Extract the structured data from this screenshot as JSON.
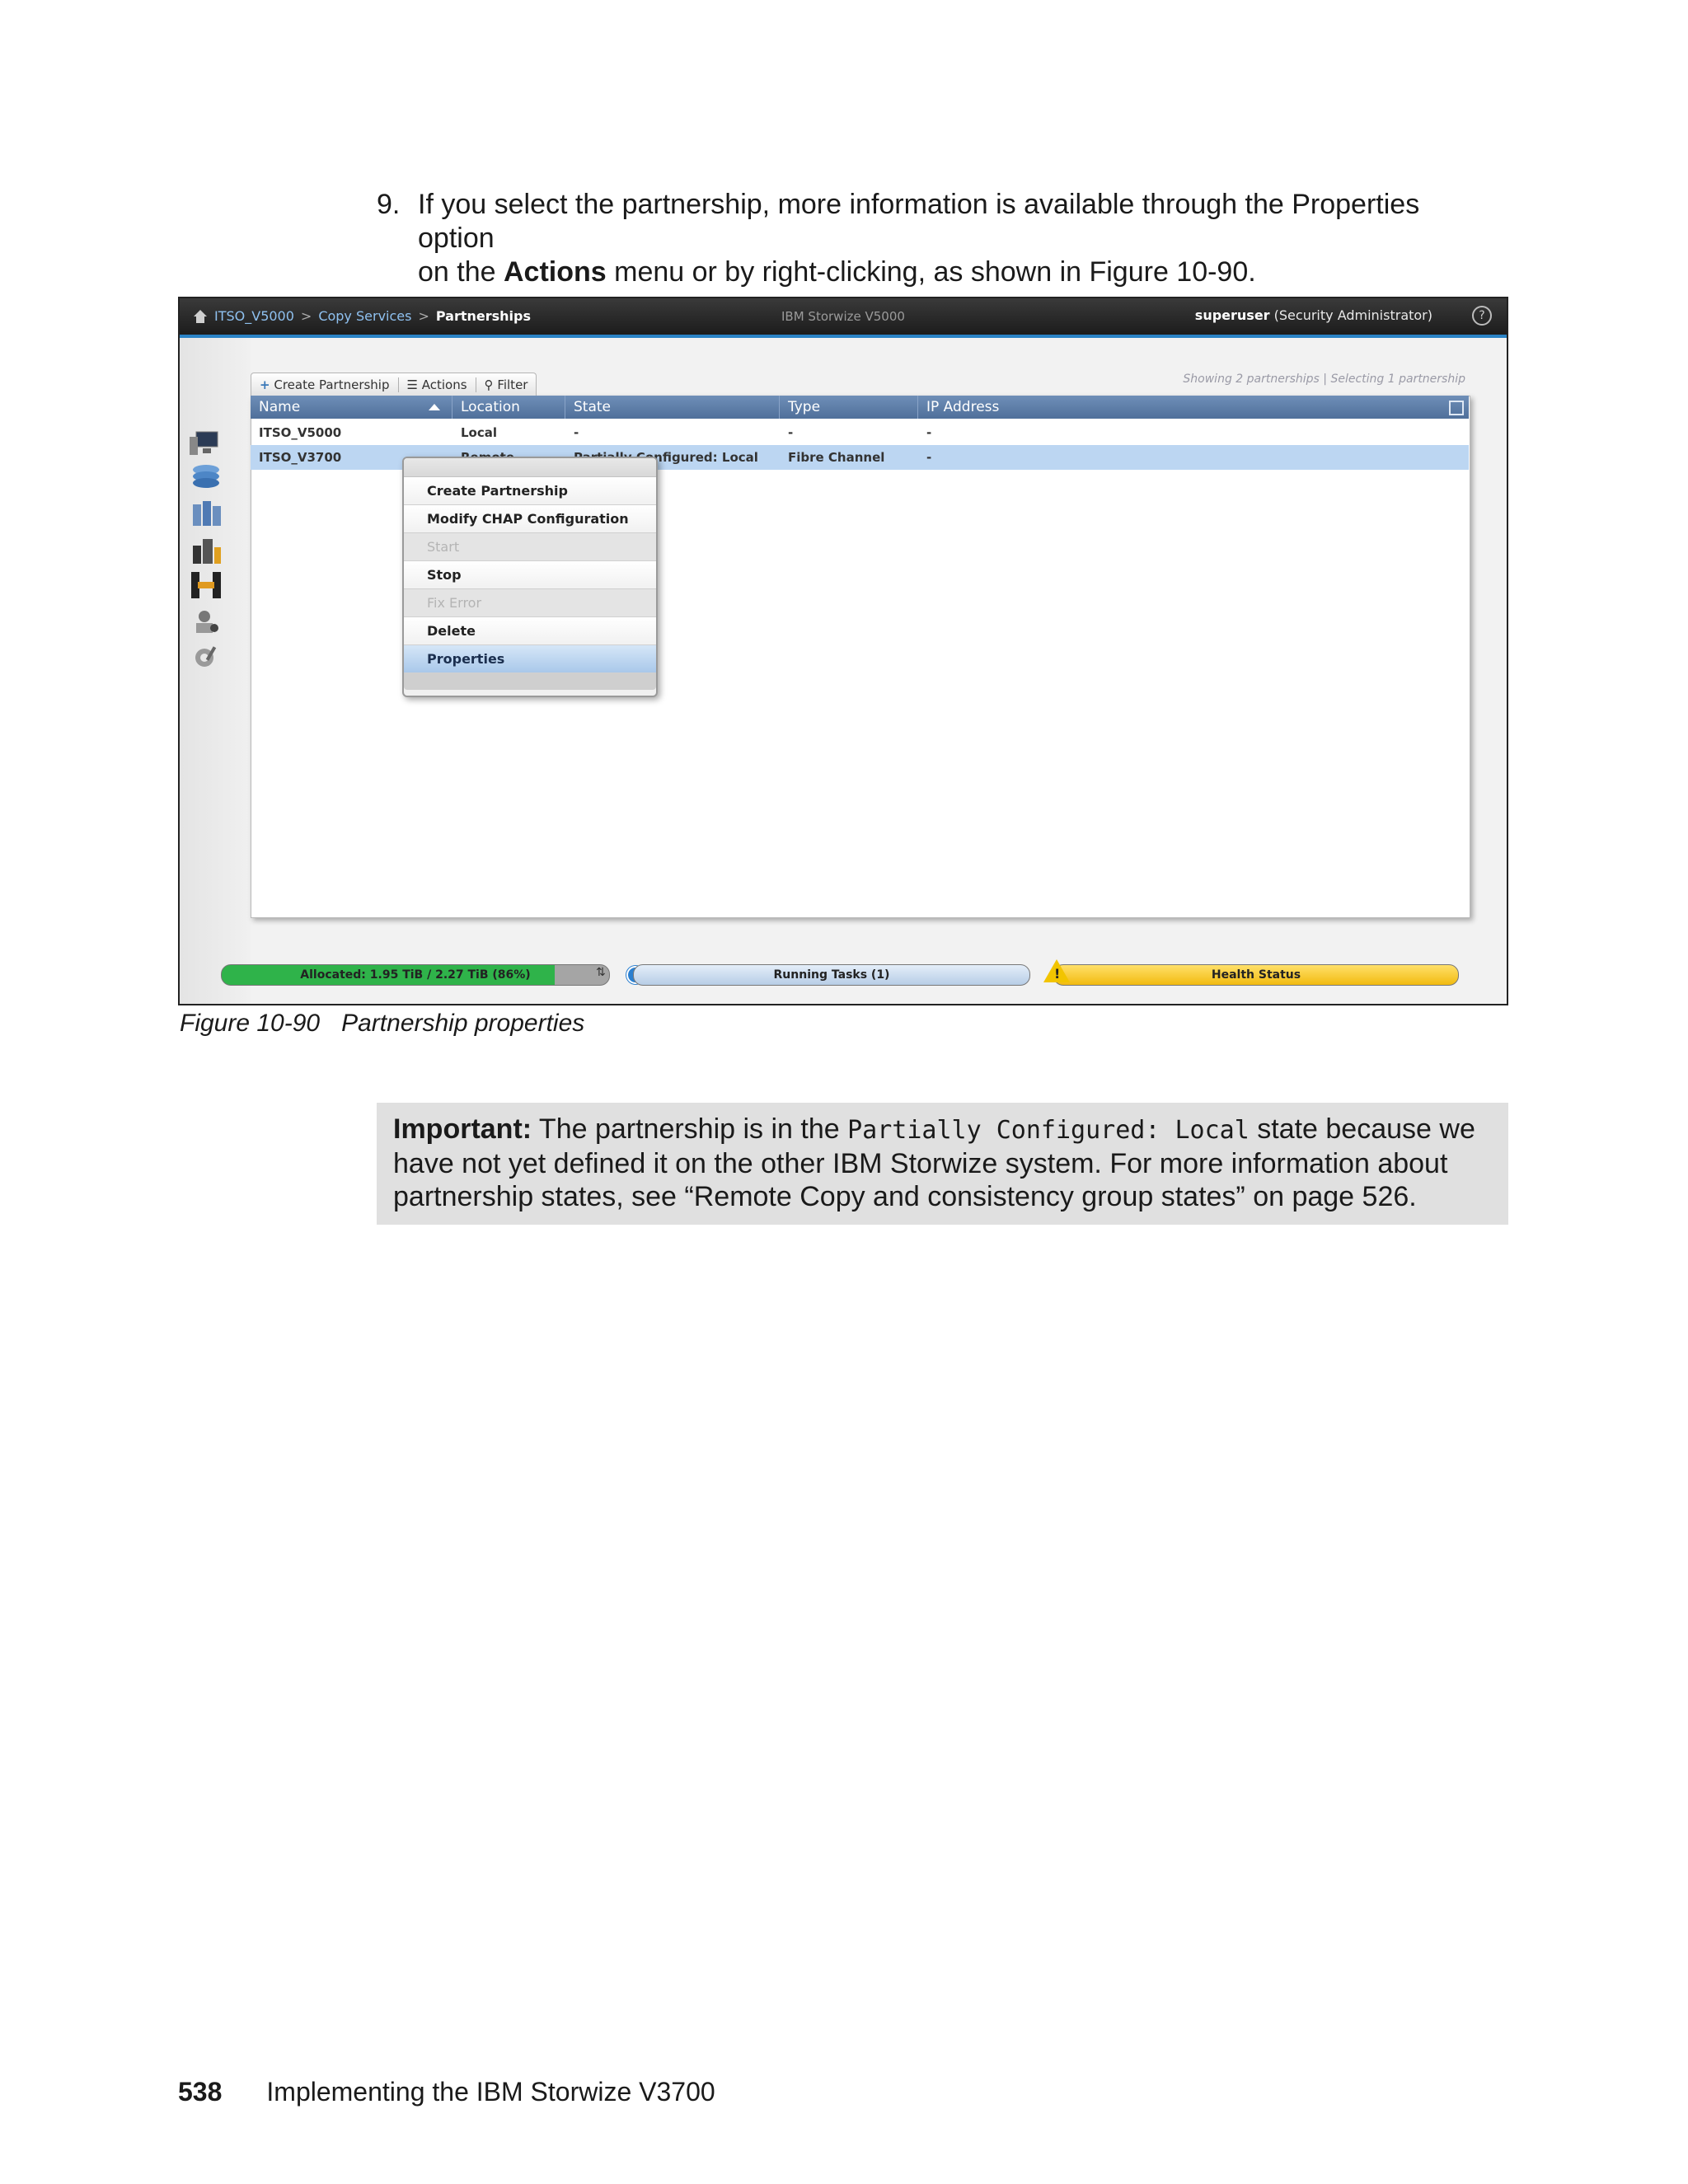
{
  "step": {
    "number": "9.",
    "line1": "If you select the partnership, more information is available through the Properties option",
    "line2_pre": "on the ",
    "line2_bold": "Actions",
    "line2_post": " menu or by right-clicking, as shown in Figure 10-90."
  },
  "app": {
    "breadcrumb": [
      "ITSO_V5000",
      "Copy Services",
      "Partnerships"
    ],
    "product": "IBM Storwize V5000",
    "user": "superuser",
    "role": "(Security Administrator)",
    "help": "?"
  },
  "toolbar": {
    "create": "Create Partnership",
    "actions": "Actions",
    "filter": "Filter",
    "showing": "Showing 2 partnerships | Selecting 1 partnership"
  },
  "table": {
    "columns": [
      "Name",
      "Location",
      "State",
      "Type",
      "IP Address"
    ],
    "rows": [
      {
        "name": "ITSO_V5000",
        "location": "Local",
        "state": "-",
        "type": "-",
        "ip": "-"
      },
      {
        "name": "ITSO_V3700",
        "location": "Remote",
        "state": "Partially Configured: Local",
        "type": "Fibre Channel",
        "ip": "-"
      }
    ]
  },
  "context_menu": {
    "items": [
      "Create Partnership",
      "Modify CHAP Configuration",
      "Start",
      "Stop",
      "Fix Error",
      "Delete",
      "Properties"
    ]
  },
  "status": {
    "allocated": "Allocated: 1.95 TiB / 2.27 TiB (86%)",
    "allocated_fraction": 0.86,
    "tasks": "Running Tasks (1)",
    "health": "Health Status"
  },
  "caption": {
    "figure": "Figure 10-90",
    "title": "Partnership properties"
  },
  "important": {
    "label": "Important:",
    "pre": " The partnership is in the ",
    "code": "Partially Configured: Local",
    "post": " state because we have not yet defined it on the other IBM Storwize system. For more information about partnership states, see “Remote Copy and consistency group states” on page 526."
  },
  "footer": {
    "page": "538",
    "title": "Implementing the IBM Storwize V3700"
  }
}
